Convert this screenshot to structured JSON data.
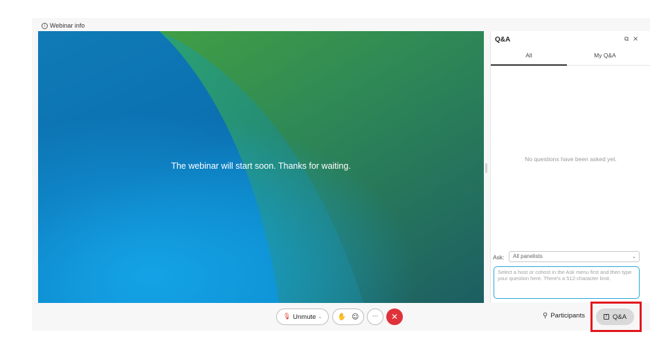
{
  "header": {
    "info_icon": "info-icon",
    "info_label": "Webinar info"
  },
  "stage": {
    "message": "The webinar will start soon. Thanks for waiting."
  },
  "qa_panel": {
    "title": "Q&A",
    "popout_icon": "popout-icon",
    "close_icon": "close-icon",
    "tabs": [
      {
        "label": "All",
        "active": true
      },
      {
        "label": "My Q&A",
        "active": false
      }
    ],
    "empty_message": "No questions have been asked yet.",
    "ask_label": "Ask:",
    "ask_select_value": "All panelists",
    "ask_placeholder": "Select a host or cohost in the Ask menu first and then type your question here. There's a 512-character limit."
  },
  "controls": {
    "unmute_label": "Unmute",
    "mic_icon": "mic-muted-icon",
    "raise_hand_icon": "raise-hand-icon",
    "reactions_icon": "smiley-icon",
    "more_icon": "more-icon",
    "leave_icon": "leave-icon",
    "participants_label": "Participants",
    "participants_icon": "person-icon",
    "qa_label": "Q&A",
    "qa_icon": "qa-icon"
  },
  "colors": {
    "highlight": "#e2171e",
    "leave": "#e0323a",
    "input_focus": "#2aa8d8"
  }
}
